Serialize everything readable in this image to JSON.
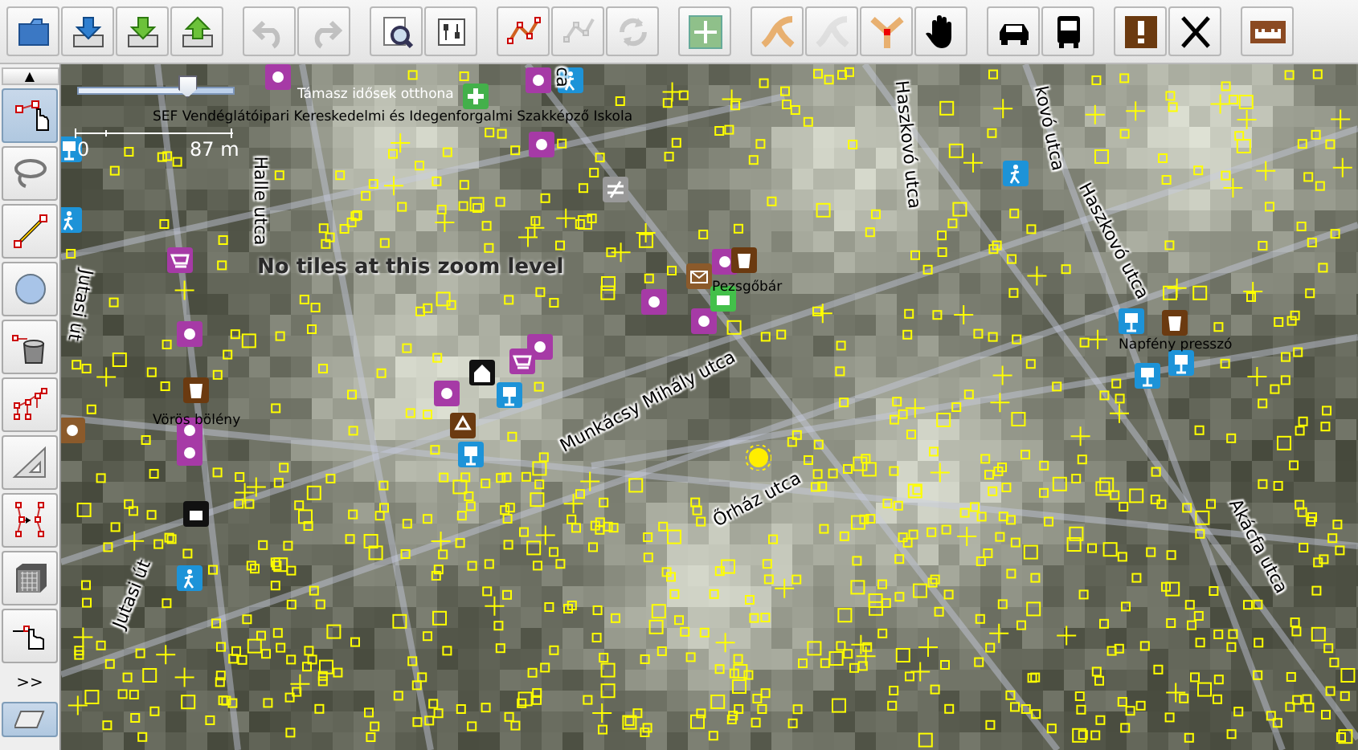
{
  "toolbar": {
    "groups": [
      [
        {
          "disabled": false
        },
        {
          "disabled": false
        },
        {
          "disabled": false
        },
        {
          "disabled": false
        }
      ],
      [
        {
          "disabled": true
        },
        {
          "disabled": true
        }
      ],
      [
        {
          "disabled": false
        },
        {
          "disabled": false
        }
      ],
      [
        {
          "disabled": false
        },
        {
          "disabled": true
        },
        {
          "disabled": true
        }
      ],
      [
        {
          "disabled": false
        }
      ],
      [
        {
          "disabled": false
        },
        {
          "disabled": true
        },
        {
          "disabled": false
        },
        {
          "disabled": false
        }
      ],
      [
        {
          "disabled": false
        },
        {
          "disabled": false
        }
      ],
      [
        {
          "disabled": false
        },
        {
          "disabled": false
        }
      ],
      [
        {
          "disabled": false
        }
      ]
    ]
  },
  "sidebar": {
    "scroll_up": "▲",
    "tools": [
      {
        "selected": true
      },
      {
        "selected": false
      },
      {
        "selected": false
      },
      {
        "selected": false
      },
      {
        "selected": false
      },
      {
        "selected": false
      },
      {
        "selected": false
      },
      {
        "selected": false
      },
      {
        "selected": false
      },
      {
        "selected": false
      }
    ],
    "more": ">>",
    "toggle": {
      "selected": true
    }
  },
  "map": {
    "zoom_slider": {
      "level": 0.7
    },
    "scale": {
      "start": "0",
      "length": "87 m"
    },
    "notice": "No tiles at this zoom level",
    "labels": [
      {
        "kind": "poi",
        "text": "Támasz idősek otthona"
      },
      {
        "kind": "poi",
        "text": "SEF Vendéglátóipari Kereskedelmi és Idegenforgalmi Szakképző Iskola"
      },
      {
        "kind": "road",
        "text": "ca"
      },
      {
        "kind": "road",
        "text": "Halle utca"
      },
      {
        "kind": "road",
        "text": "Jutasi út"
      },
      {
        "kind": "poi",
        "text": "Vörös bölény"
      },
      {
        "kind": "road",
        "text": "Munkácsy Mihály utca"
      },
      {
        "kind": "poi",
        "text": "Pezsgőbár"
      },
      {
        "kind": "road",
        "text": "Haszkovó utca"
      },
      {
        "kind": "road",
        "text": "kovó utca"
      },
      {
        "kind": "road",
        "text": "Haszkovó utca"
      },
      {
        "kind": "poi",
        "text": "Napfény presszó"
      },
      {
        "kind": "road",
        "text": "Őrház utca"
      },
      {
        "kind": "road",
        "text": "Akácfa utca"
      },
      {
        "kind": "road",
        "text": "Jutasi út"
      }
    ]
  }
}
